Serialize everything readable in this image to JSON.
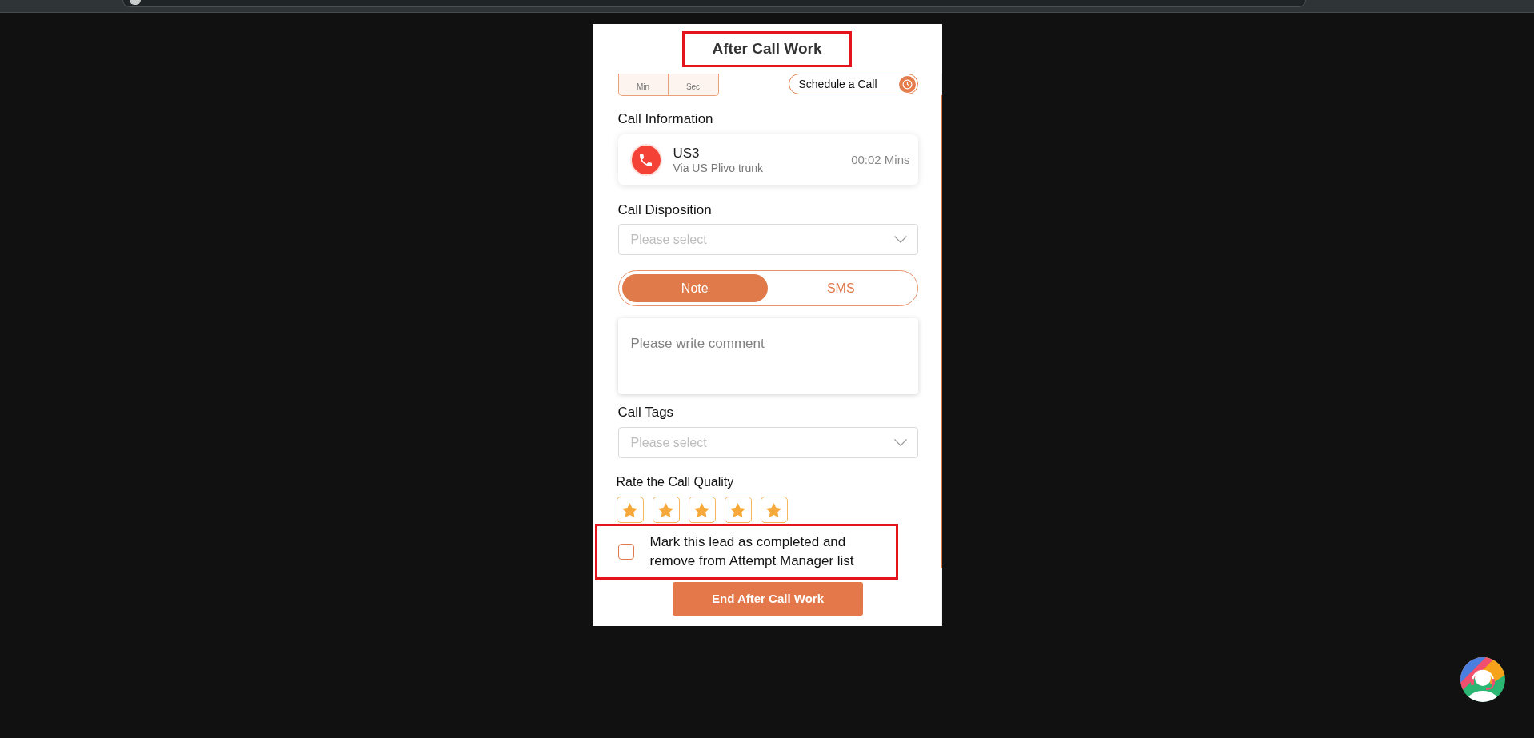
{
  "title": {
    "text": "After Call Work",
    "highlighted": true
  },
  "timer": [
    {
      "label": "Min"
    },
    {
      "label": "Sec"
    }
  ],
  "schedule_button": {
    "label": "Schedule a Call"
  },
  "call_information": {
    "heading": "Call Information",
    "name": "US3",
    "route": "Via US Plivo trunk",
    "duration": "00:02 Mins"
  },
  "call_disposition": {
    "label": "Call Disposition",
    "placeholder": "Please select"
  },
  "tabs": [
    {
      "label": "Note",
      "selected": true
    },
    {
      "label": "SMS",
      "selected": false
    }
  ],
  "comment": {
    "placeholder": "Please write comment"
  },
  "call_tags": {
    "label": "Call Tags",
    "placeholder": "Please select"
  },
  "rating": {
    "label": "Rate the Call Quality",
    "stars": 5
  },
  "complete_lead": {
    "label": "Mark this lead as completed and remove from Attempt Manager list",
    "checked": false,
    "highlighted": true
  },
  "end_button": {
    "label": "End After Call Work"
  }
}
